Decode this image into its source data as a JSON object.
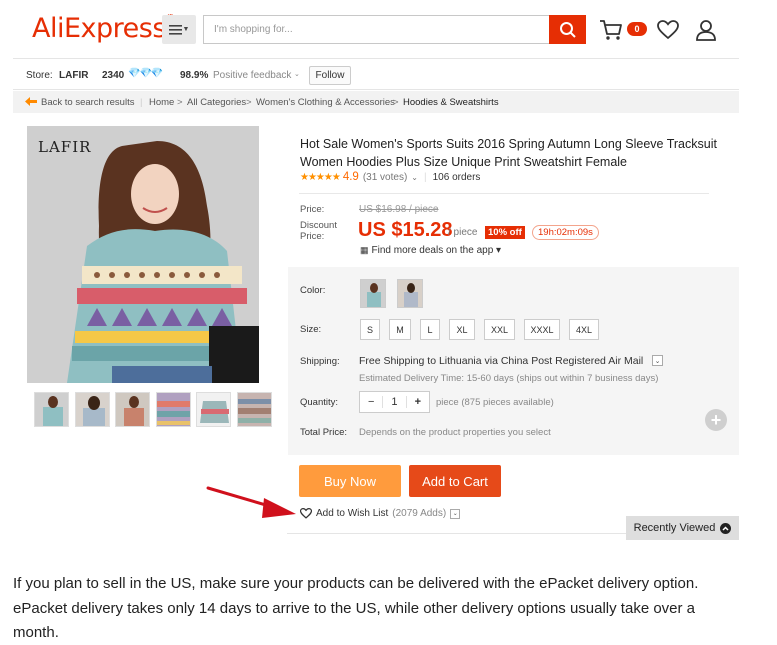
{
  "header": {
    "logo": "AliExpress",
    "logo_tm": "™",
    "search_placeholder": "I'm shopping for...",
    "cart_count": "0"
  },
  "store": {
    "label": "Store:",
    "name": "LAFIR",
    "score": "2340",
    "feedback_pct": "98.9%",
    "feedback_label": "Positive feedback",
    "follow_label": "Follow"
  },
  "breadcrumb": {
    "back": "Back to search results",
    "items": [
      "Home",
      "All Categories",
      "Women's Clothing & Accessories",
      "Hoodies & Sweatshirts"
    ],
    "sep": ">"
  },
  "product": {
    "brand_overlay": "LAFIR",
    "title": "Hot Sale Women's Sports Suits 2016 Spring Autumn Long Sleeve Tracksuit Women Hoodies Plus Size Unique Print Sweatshirt Female",
    "stars": "★★★★★",
    "rating": "4.9",
    "votes": "(31 votes)",
    "orders": "106 orders",
    "price_label": "Price:",
    "old_price": "US $16.98 / piece",
    "discount_label_1": "Discount",
    "discount_label_2": "Price:",
    "price": "US $15.28",
    "per": "/ piece",
    "discount": "10% off",
    "timer": "19h:02m:09s",
    "app_deal": "Find more deals on the app ▾",
    "color_label": "Color:",
    "size_label": "Size:",
    "sizes": [
      "S",
      "M",
      "L",
      "XL",
      "XXL",
      "XXXL",
      "4XL"
    ],
    "shipping_label": "Shipping:",
    "shipping": "Free Shipping to Lithuania via China Post Registered Air Mail",
    "estimated": "Estimated Delivery Time: 15-60 days (ships out within 7 business days)",
    "quantity_label": "Quantity:",
    "quantity": "1",
    "qty_minus": "−",
    "qty_plus": "+",
    "qty_info": "piece (875 pieces available)",
    "total_label": "Total Price:",
    "total_info": "Depends on the product properties you select",
    "buy_now": "Buy Now",
    "add_to_cart": "Add to Cart",
    "wishlist": "Add to Wish List",
    "wishlist_count": "(2079 Adds)"
  },
  "recently_viewed": "Recently Viewed",
  "paragraph": "If you plan to sell in the US, make sure your products can be delivered with the ePacket delivery option. ePacket delivery takes only 14 days to arrive to the US, while other delivery options usually take over a month.",
  "colors": {
    "brand": "#e62e04",
    "buy_now": "#ff9b3d",
    "add_cart": "#e64a19",
    "arrow": "#d0101c"
  }
}
